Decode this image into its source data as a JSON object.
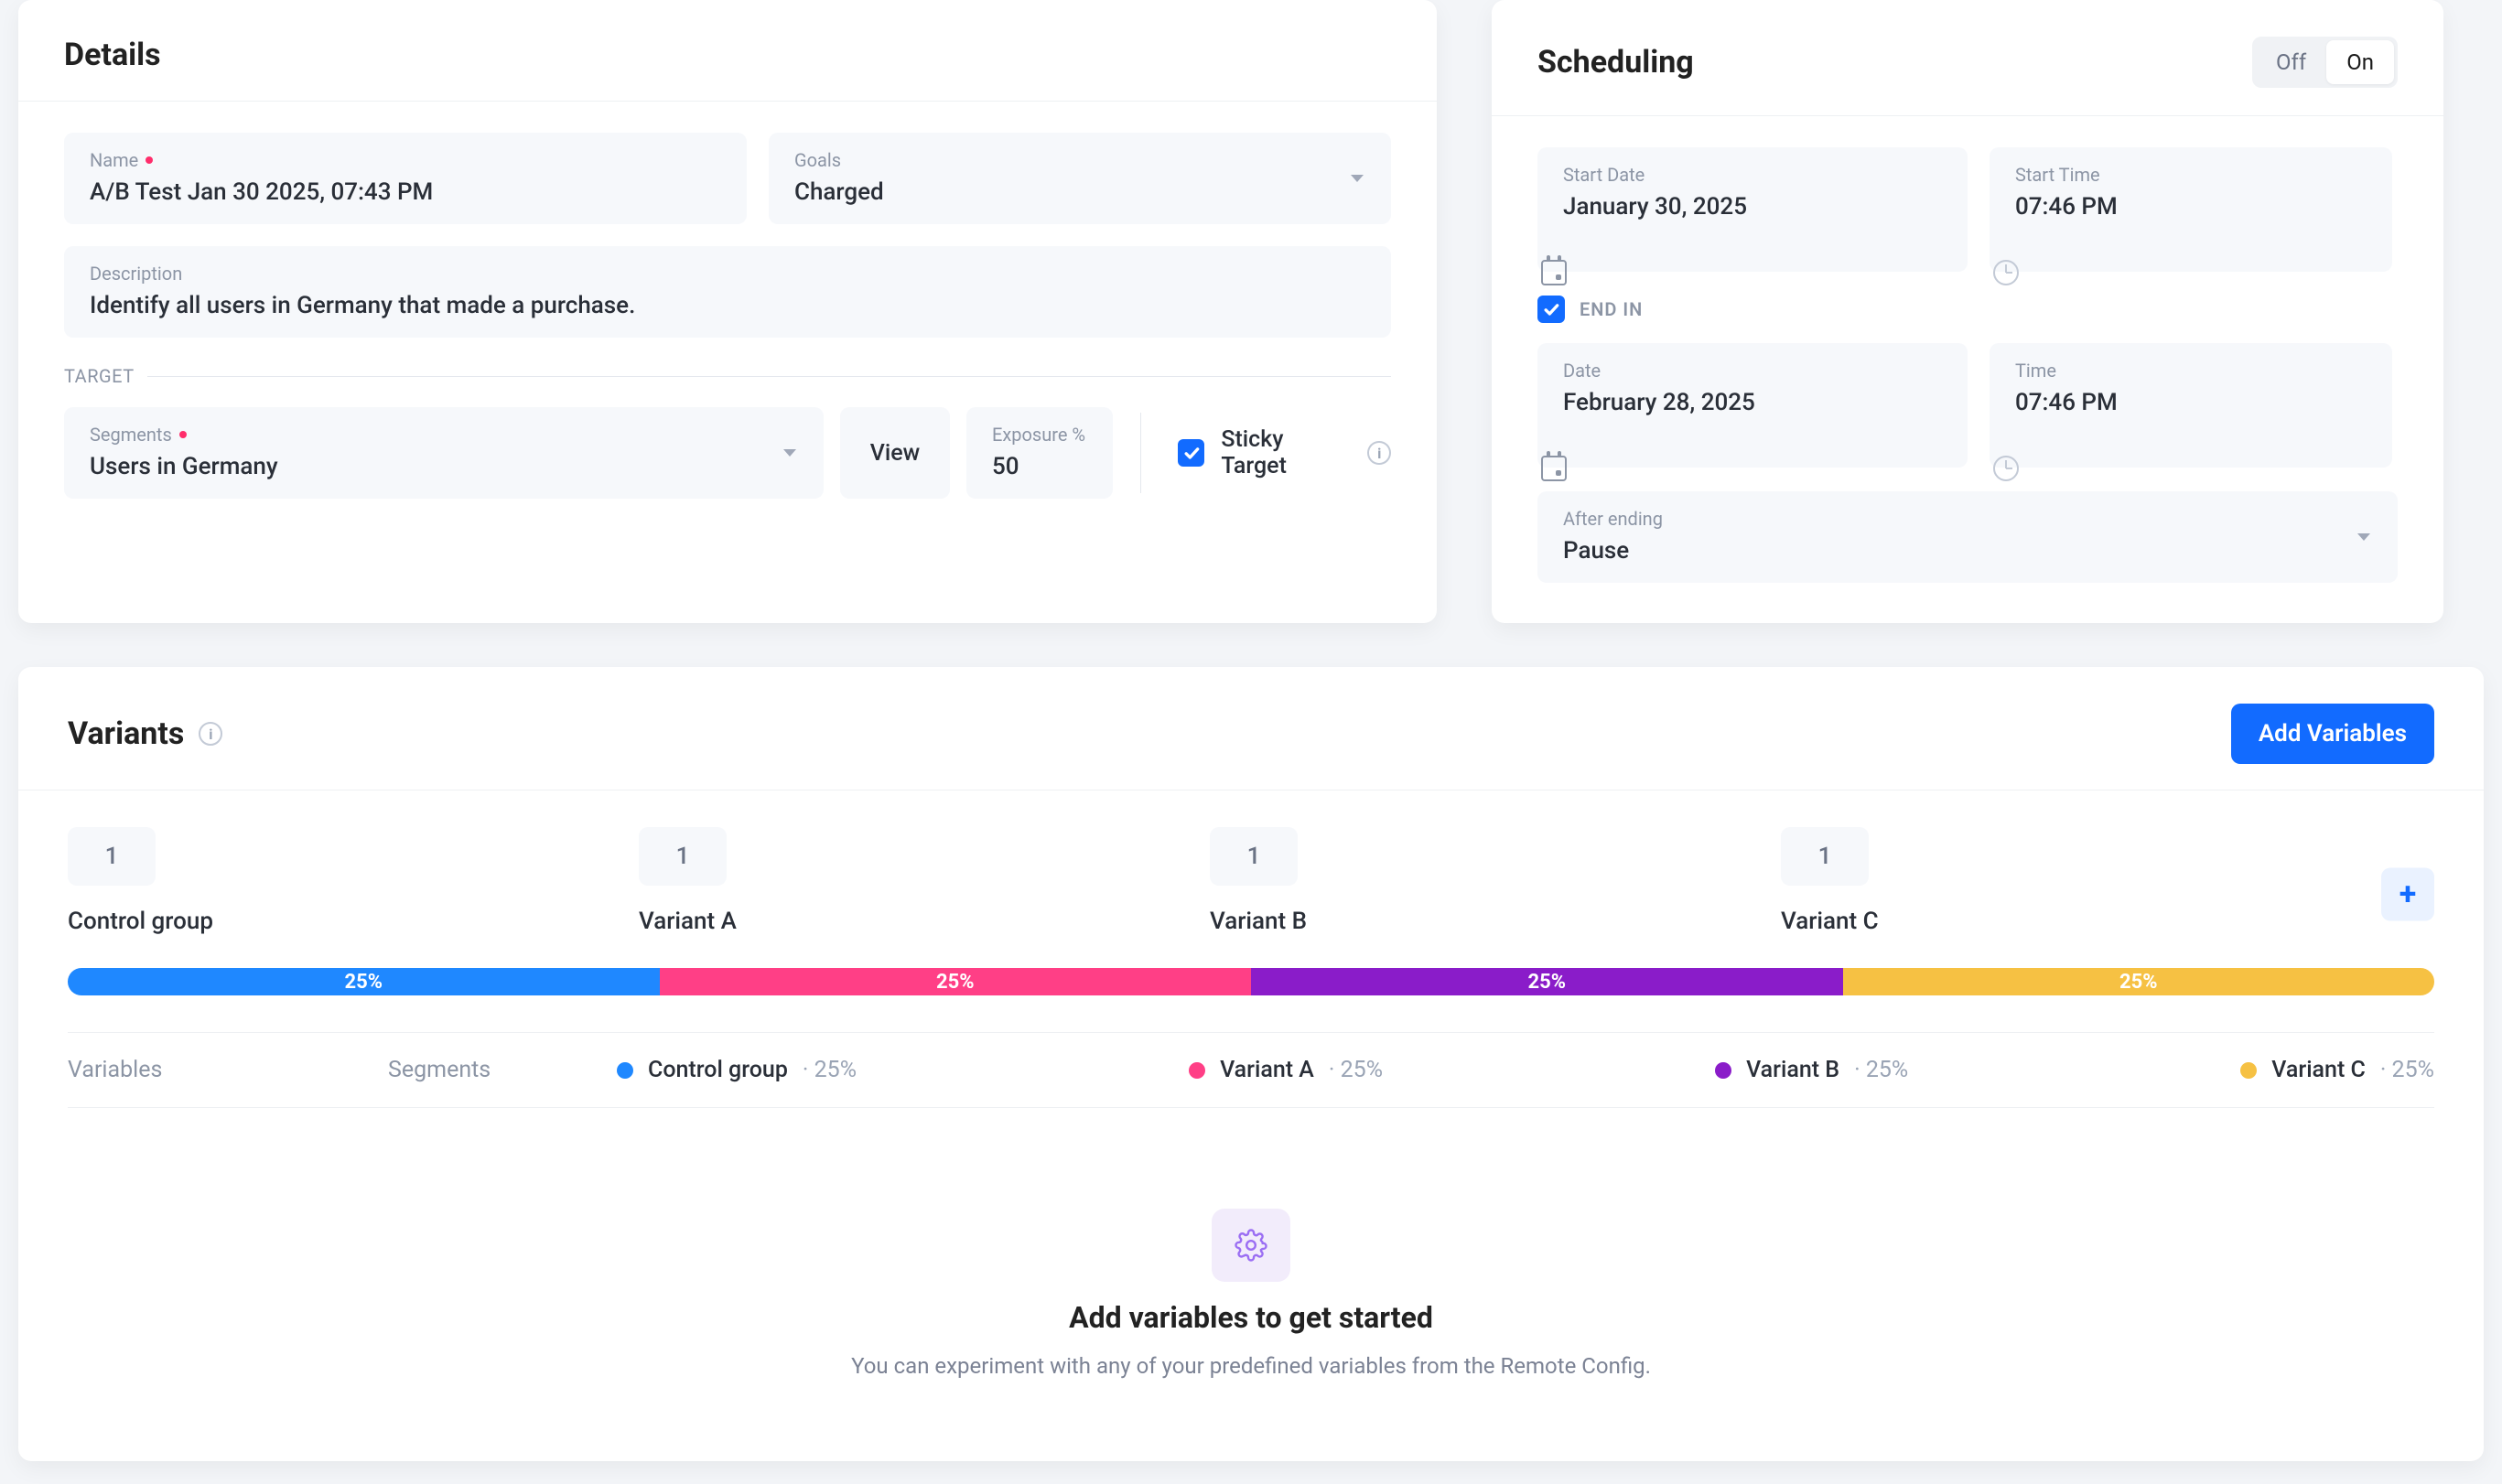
{
  "colors": {
    "blue": "#1f88ff",
    "pink": "#ff3f86",
    "purple": "#8a1cc9",
    "yellow": "#f6c143",
    "primary": "#126bff"
  },
  "details": {
    "title": "Details",
    "name_label": "Name",
    "name_value": "A/B Test Jan 30 2025, 07:43 PM",
    "goals_label": "Goals",
    "goals_value": "Charged",
    "description_label": "Description",
    "description_value": "Identify all users in Germany that made a purchase.",
    "target_label": "TARGET",
    "segments_label": "Segments",
    "segments_value": "Users in Germany",
    "view_label": "View",
    "exposure_label": "Exposure %",
    "exposure_value": "50",
    "sticky_checked": true,
    "sticky_label": "Sticky Target"
  },
  "scheduling": {
    "title": "Scheduling",
    "toggle_off": "Off",
    "toggle_on": "On",
    "toggle_value": "On",
    "start_date_label": "Start Date",
    "start_date_value": "January 30, 2025",
    "start_time_label": "Start Time",
    "start_time_value": "07:46 PM",
    "end_in_checked": true,
    "end_in_label": "END IN",
    "end_date_label": "Date",
    "end_date_value": "February 28, 2025",
    "end_time_label": "Time",
    "end_time_value": "07:46 PM",
    "after_ending_label": "After ending",
    "after_ending_value": "Pause"
  },
  "variants": {
    "title": "Variants",
    "add_variables_label": "Add Variables",
    "items": [
      {
        "count": "1",
        "name": "Control group",
        "pct": "25%",
        "color": "#1f88ff"
      },
      {
        "count": "1",
        "name": "Variant A",
        "pct": "25%",
        "color": "#ff3f86"
      },
      {
        "count": "1",
        "name": "Variant B",
        "pct": "25%",
        "color": "#8a1cc9"
      },
      {
        "count": "1",
        "name": "Variant C",
        "pct": "25%",
        "color": "#f6c143"
      }
    ],
    "table_headers": {
      "variables": "Variables",
      "segments": "Segments"
    },
    "empty": {
      "title": "Add variables to get started",
      "subtitle": "You can experiment with any of your predefined variables from the Remote Config."
    }
  }
}
